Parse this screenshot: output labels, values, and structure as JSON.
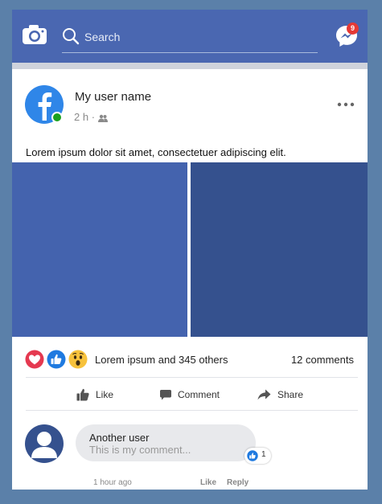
{
  "header": {
    "search_placeholder": "Search",
    "messenger_badge": "9",
    "bar_color": "#4a67b1"
  },
  "post": {
    "user_name": "My user name",
    "time": "2 h",
    "privacy_icon": "friends-icon",
    "text": "Lorem ipsum dolor sit amet, consectetuer adipiscing elit.",
    "reactions_text": "Lorem ipsum and  345 others",
    "comments_count": "12 comments",
    "image_colors": [
      "#4463ae",
      "#35518e"
    ]
  },
  "actions": {
    "like": "Like",
    "comment": "Comment",
    "share": "Share"
  },
  "comment": {
    "user": "Another user",
    "text": "This is my comment...",
    "like_count": "1",
    "time": "1 hour ago",
    "like": "Like",
    "reply": "Reply"
  }
}
